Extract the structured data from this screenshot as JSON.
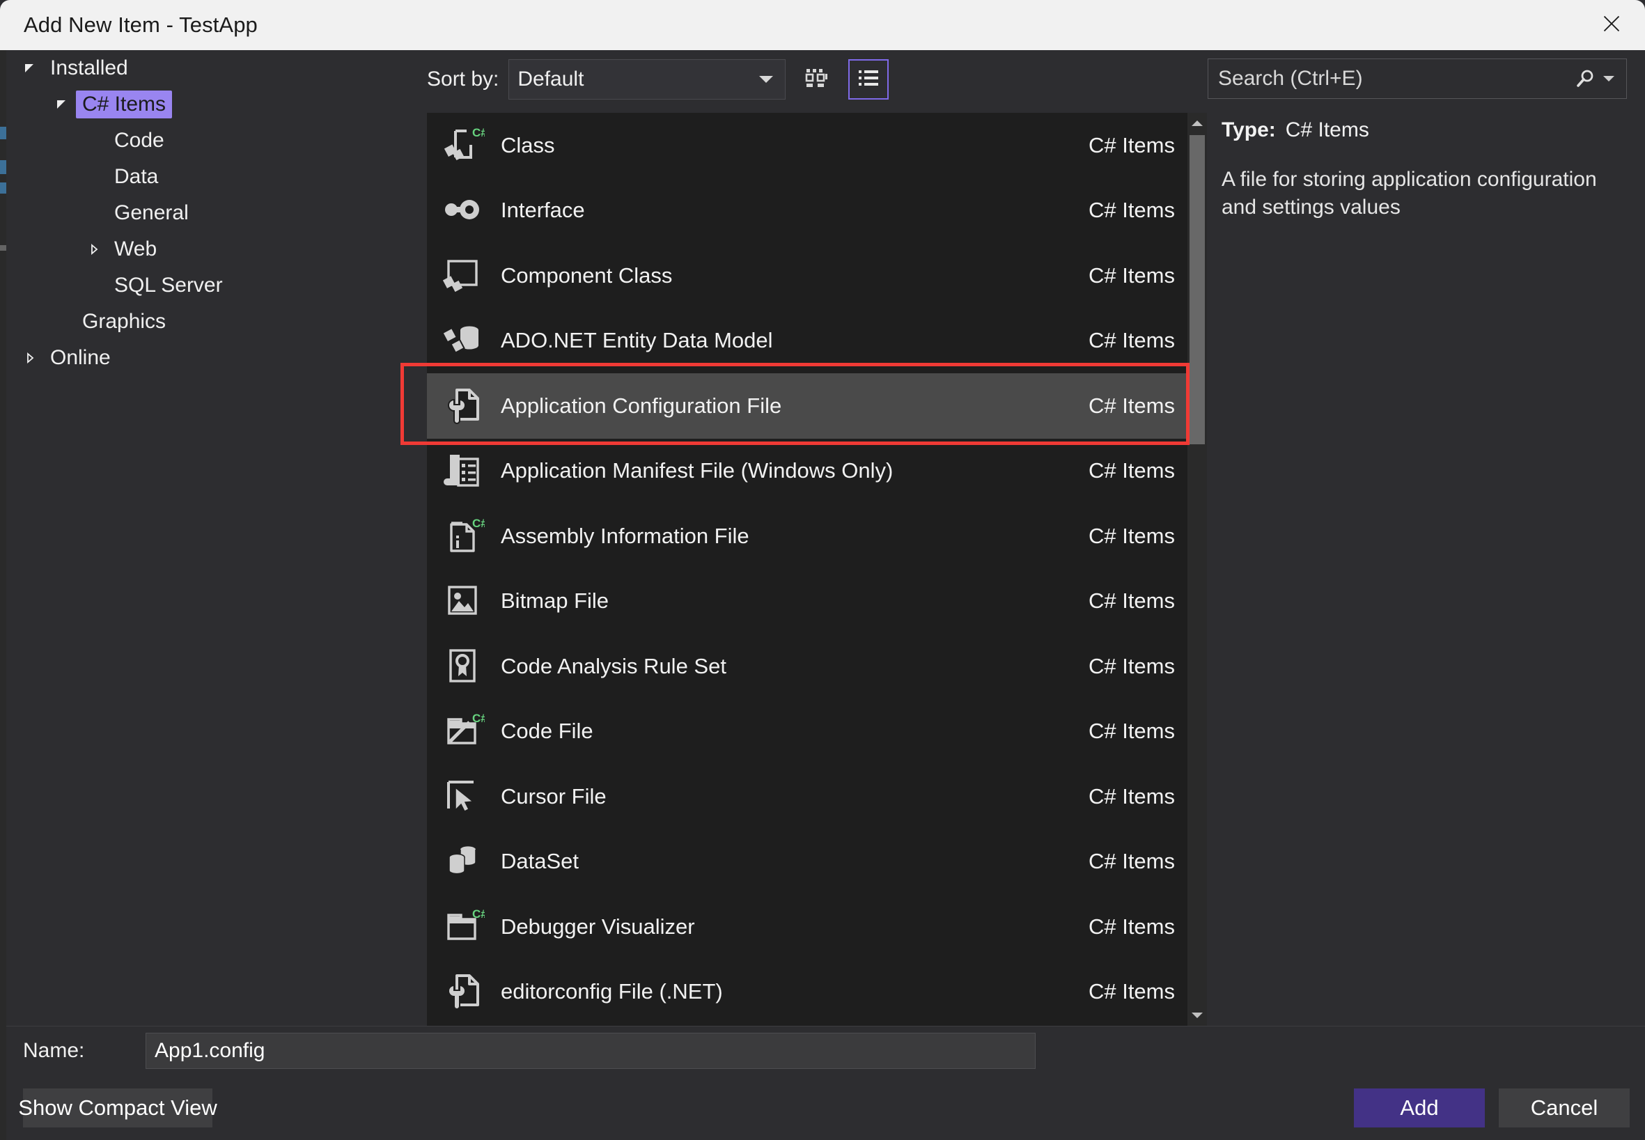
{
  "window": {
    "title": "Add New Item - TestApp",
    "close_icon": "close-icon"
  },
  "sidebar": {
    "items": [
      {
        "label": "Installed",
        "indent": 0,
        "twisty": "expanded",
        "selected": false
      },
      {
        "label": "C# Items",
        "indent": 1,
        "twisty": "expanded",
        "selected": true
      },
      {
        "label": "Code",
        "indent": 2,
        "twisty": "none",
        "selected": false
      },
      {
        "label": "Data",
        "indent": 2,
        "twisty": "none",
        "selected": false
      },
      {
        "label": "General",
        "indent": 2,
        "twisty": "none",
        "selected": false
      },
      {
        "label": "Web",
        "indent": 2,
        "twisty": "collapsed",
        "selected": false
      },
      {
        "label": "SQL Server",
        "indent": 2,
        "twisty": "none",
        "selected": false
      },
      {
        "label": "Graphics",
        "indent": 1,
        "twisty": "none",
        "selected": false
      },
      {
        "label": "Online",
        "indent": 0,
        "twisty": "collapsed",
        "selected": false
      }
    ]
  },
  "toolbar": {
    "sort_label": "Sort by:",
    "sort_value": "Default",
    "grid_view_icon": "grid-view-icon",
    "list_view_icon": "list-view-icon",
    "active_view": "list"
  },
  "search": {
    "placeholder": "Search (Ctrl+E)",
    "icon": "search-icon",
    "caret_icon": "chevron-down-icon"
  },
  "list": {
    "items": [
      {
        "name": "Class",
        "category": "C# Items",
        "icon": "class-csharp-icon",
        "selected": false
      },
      {
        "name": "Interface",
        "category": "C# Items",
        "icon": "interface-icon",
        "selected": false
      },
      {
        "name": "Component Class",
        "category": "C# Items",
        "icon": "component-class-icon",
        "selected": false
      },
      {
        "name": "ADO.NET Entity Data Model",
        "category": "C# Items",
        "icon": "entity-data-model-icon",
        "selected": false
      },
      {
        "name": "Application Configuration File",
        "category": "C# Items",
        "icon": "config-file-icon",
        "selected": true
      },
      {
        "name": "Application Manifest File (Windows Only)",
        "category": "C# Items",
        "icon": "manifest-file-icon",
        "selected": false
      },
      {
        "name": "Assembly Information File",
        "category": "C# Items",
        "icon": "assembly-info-icon",
        "selected": false
      },
      {
        "name": "Bitmap File",
        "category": "C# Items",
        "icon": "bitmap-file-icon",
        "selected": false
      },
      {
        "name": "Code Analysis Rule Set",
        "category": "C# Items",
        "icon": "rule-set-icon",
        "selected": false
      },
      {
        "name": "Code File",
        "category": "C# Items",
        "icon": "code-file-icon",
        "selected": false
      },
      {
        "name": "Cursor File",
        "category": "C# Items",
        "icon": "cursor-file-icon",
        "selected": false
      },
      {
        "name": "DataSet",
        "category": "C# Items",
        "icon": "dataset-icon",
        "selected": false
      },
      {
        "name": "Debugger Visualizer",
        "category": "C# Items",
        "icon": "debugger-visualizer-icon",
        "selected": false
      },
      {
        "name": "editorconfig File (.NET)",
        "category": "C# Items",
        "icon": "editorconfig-icon",
        "selected": false
      }
    ]
  },
  "info": {
    "type_label": "Type:",
    "type_value": "C# Items",
    "description": "A file for storing application configuration and settings values"
  },
  "name_field": {
    "label": "Name:",
    "value": "App1.config"
  },
  "footer": {
    "compact_view_label": "Show Compact View",
    "add_label": "Add",
    "cancel_label": "Cancel"
  },
  "colors": {
    "accent_purple": "#433286",
    "selection_purple": "#9985f0",
    "annotation_red": "#f03a35",
    "csharp_green": "#67d37f",
    "dialog_bg": "#2d2d30",
    "list_bg": "#1e1e1e",
    "titlebar_bg": "#f1f1f1"
  }
}
